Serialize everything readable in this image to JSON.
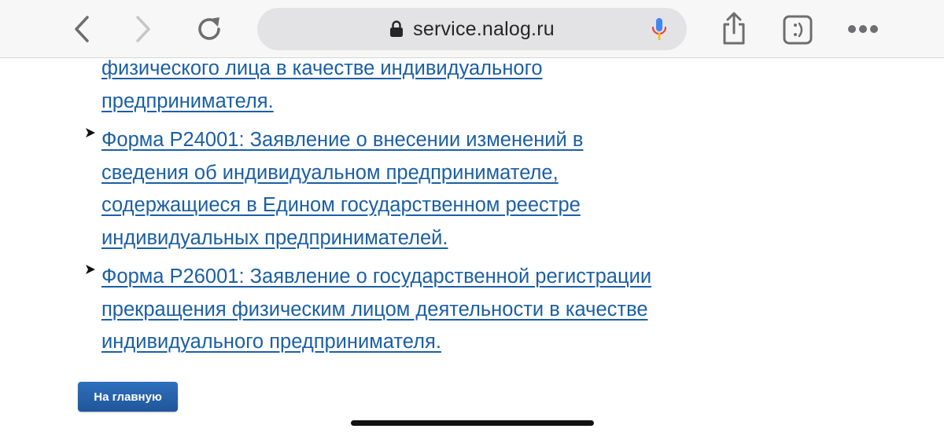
{
  "browser": {
    "url": "service.nalog.ru",
    "icons": {
      "back": "chevron-left-icon",
      "forward": "chevron-right-icon",
      "reload": "reload-icon",
      "lock": "lock-icon",
      "mic": "microphone-icon",
      "share": "share-icon",
      "reader": "reader-icon",
      "more": "more-icon"
    },
    "colors": {
      "toolbar_bg": "#f7f7f7",
      "urlbar_bg": "#e3e3e5",
      "mic_blue": "#4285f4",
      "mic_red": "#ea4335"
    }
  },
  "links": [
    {
      "lines": [
        "физического лица в качестве индивидуального",
        "предпринимателя."
      ]
    },
    {
      "lines": [
        "Форма Р24001: Заявление о внесении изменений в",
        "сведения об индивидуальном предпринимателе,",
        "содержащиеся в Едином государственном реестре",
        "индивидуальных предпринимателей."
      ]
    },
    {
      "lines": [
        "Форма Р26001: Заявление о государственной регистрации",
        "прекращения физическим лицом деятельности в качестве",
        "индивидуального предпринимателя."
      ]
    }
  ],
  "home_button": {
    "label": "На главную"
  },
  "colors": {
    "link": "#1b5fa6",
    "button": "#2563a8"
  }
}
